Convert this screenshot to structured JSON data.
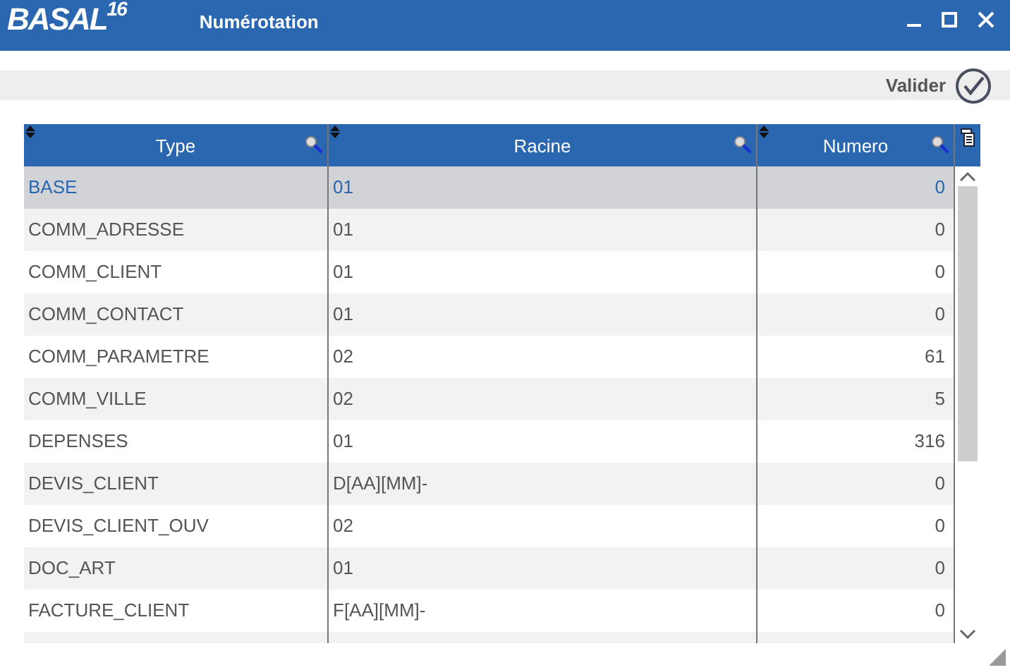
{
  "window": {
    "logo": "BASAL",
    "logo_version": "16",
    "title": "Numérotation"
  },
  "toolbar": {
    "validate_label": "Valider"
  },
  "table": {
    "columns": [
      "Type",
      "Racine",
      "Numero"
    ],
    "rows": [
      {
        "type": "BASE",
        "racine": "01",
        "numero": "0",
        "selected": true
      },
      {
        "type": "COMM_ADRESSE",
        "racine": "01",
        "numero": "0",
        "selected": false
      },
      {
        "type": "COMM_CLIENT",
        "racine": "01",
        "numero": "0",
        "selected": false
      },
      {
        "type": "COMM_CONTACT",
        "racine": "01",
        "numero": "0",
        "selected": false
      },
      {
        "type": "COMM_PARAMETRE",
        "racine": "02",
        "numero": "61",
        "selected": false
      },
      {
        "type": "COMM_VILLE",
        "racine": "02",
        "numero": "5",
        "selected": false
      },
      {
        "type": "DEPENSES",
        "racine": "01",
        "numero": "316",
        "selected": false
      },
      {
        "type": "DEVIS_CLIENT",
        "racine": "D[AA][MM]-",
        "numero": "0",
        "selected": false
      },
      {
        "type": "DEVIS_CLIENT_OUV",
        "racine": "02",
        "numero": "0",
        "selected": false
      },
      {
        "type": "DOC_ART",
        "racine": "01",
        "numero": "0",
        "selected": false
      },
      {
        "type": "FACTURE_CLIENT",
        "racine": "F[AA][MM]-",
        "numero": "0",
        "selected": false
      }
    ]
  }
}
